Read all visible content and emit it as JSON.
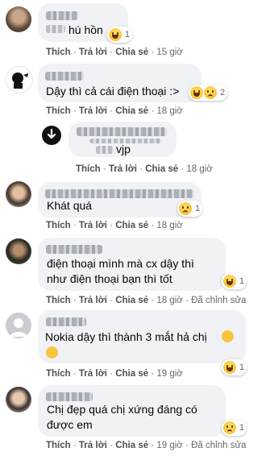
{
  "actions": {
    "like": "Thích",
    "reply": "Trả lời",
    "share": "Chia sẻ",
    "separator": "·",
    "edited": "Đã chỉnh sửa"
  },
  "comments": [
    {
      "text": "hú hồn",
      "time": "15 giờ",
      "reaction_count": "1",
      "reactions": [
        "haha"
      ]
    },
    {
      "text": "Dậy thì cả cái điện thoại :>",
      "time": "18 giờ",
      "reaction_count": "2",
      "reactions": [
        "haha",
        "sad"
      ]
    },
    {
      "text": "vjp",
      "time": "18 giờ"
    },
    {
      "text": "Khát quá",
      "time": "18 giờ",
      "reaction_count": "1",
      "reactions": [
        "sad"
      ]
    },
    {
      "text_line1": "điện thoại mình mà cx dậy thì",
      "text_line2": "như điện thoại bạn thì tốt",
      "time": "18 giờ",
      "reaction_count": "1",
      "reactions": [
        "haha"
      ]
    },
    {
      "text": "Nokia dậy thì thành 3 mắt hả chị",
      "time": "19 giờ",
      "reaction_count": "1",
      "reactions": [
        "haha"
      ],
      "inline_emojis": [
        "thinking-face",
        "grinning-face"
      ]
    },
    {
      "text_line1": "Chị đẹp quá chị xứng đáng có",
      "text_line2": "được em",
      "time": "19 giờ",
      "reaction_count": "1",
      "reactions": [
        "sad"
      ]
    }
  ]
}
